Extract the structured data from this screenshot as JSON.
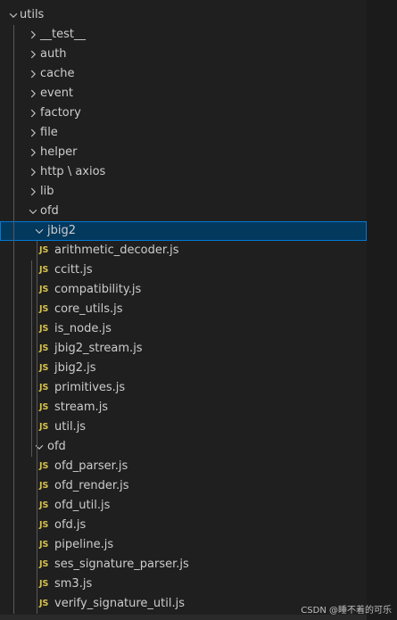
{
  "explorer": {
    "root": {
      "label": "utils",
      "expanded": true
    },
    "folders": [
      {
        "label": "__test__"
      },
      {
        "label": "auth"
      },
      {
        "label": "cache"
      },
      {
        "label": "event"
      },
      {
        "label": "factory"
      },
      {
        "label": "file"
      },
      {
        "label": "helper"
      },
      {
        "label": "http \\ axios"
      },
      {
        "label": "lib"
      }
    ],
    "ofd_folder": {
      "label": "ofd",
      "expanded": true
    },
    "jbig2_folder": {
      "label": "jbig2",
      "expanded": true,
      "selected": true
    },
    "jbig2_files": [
      {
        "icon": "JS",
        "label": "arithmetic_decoder.js"
      },
      {
        "icon": "JS",
        "label": "ccitt.js"
      },
      {
        "icon": "JS",
        "label": "compatibility.js"
      },
      {
        "icon": "JS",
        "label": "core_utils.js"
      },
      {
        "icon": "JS",
        "label": "is_node.js"
      },
      {
        "icon": "JS",
        "label": "jbig2_stream.js"
      },
      {
        "icon": "JS",
        "label": "jbig2.js"
      },
      {
        "icon": "JS",
        "label": "primitives.js"
      },
      {
        "icon": "JS",
        "label": "stream.js"
      },
      {
        "icon": "JS",
        "label": "util.js"
      }
    ],
    "ofd_sub_folder": {
      "label": "ofd",
      "expanded": true
    },
    "ofd_files": [
      {
        "icon": "JS",
        "label": "ofd_parser.js"
      },
      {
        "icon": "JS",
        "label": "ofd_render.js"
      },
      {
        "icon": "JS",
        "label": "ofd_util.js"
      },
      {
        "icon": "JS",
        "label": "ofd.js"
      },
      {
        "icon": "JS",
        "label": "pipeline.js"
      },
      {
        "icon": "JS",
        "label": "ses_signature_parser.js"
      },
      {
        "icon": "JS",
        "label": "sm3.js"
      },
      {
        "icon": "JS",
        "label": "verify_signature_util.js"
      }
    ]
  },
  "watermark": "CSDN @睡不着的可乐",
  "colors": {
    "background": "#1f1f1f",
    "text": "#cccccc",
    "js_icon": "#d8c24b",
    "selection_bg": "#04395e",
    "selection_border": "#0078d4"
  }
}
